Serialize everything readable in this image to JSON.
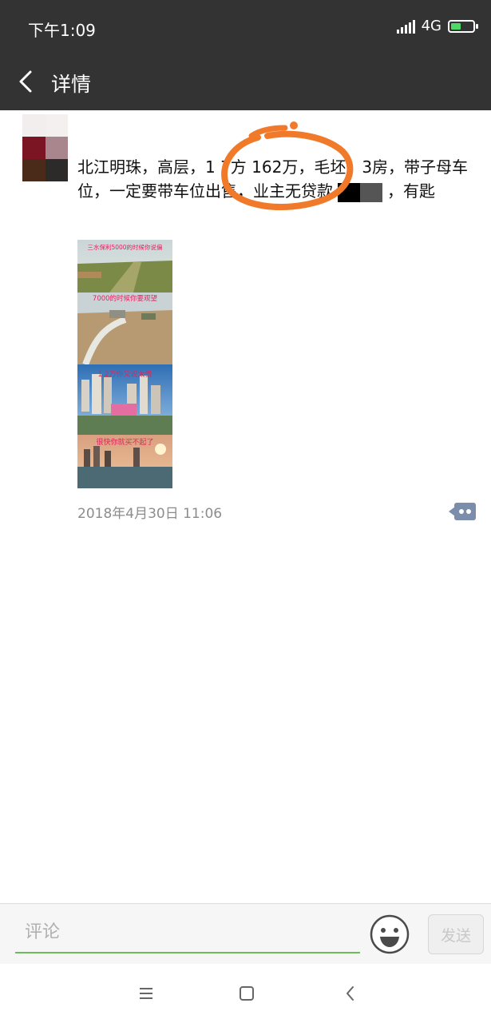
{
  "status_bar": {
    "time": "下午1:09",
    "network": "4G",
    "signal_icon": "signal-bars-icon",
    "battery_icon": "battery-charging-icon"
  },
  "nav": {
    "title": "详情",
    "back_icon": "chevron-left-icon"
  },
  "post": {
    "text_main": "北江明珠，高层，1 7方 162万，毛坯，3房，带子母车位，一定要带车位出售，业主无贷款",
    "text_tail": "，有匙",
    "image_captions": [
      "三水保利5000的时候你说偏",
      "7000的时候你要观望",
      "1.2万你又说太贵",
      "很快你就买不起了"
    ],
    "timestamp": "2018年4月30日 11:06",
    "annotation_color": "#f07a2a"
  },
  "comment_bar": {
    "placeholder": "评论",
    "send_label": "发送",
    "emoji_icon": "smiley-icon"
  },
  "system_nav": {
    "menu_icon": "menu-icon",
    "home_icon": "square-home-icon",
    "back_icon": "back-triangle-icon"
  },
  "colors": {
    "bar_bg": "#333333",
    "input_underline": "#6cbc5c",
    "timestamp": "#8c8c8c"
  }
}
